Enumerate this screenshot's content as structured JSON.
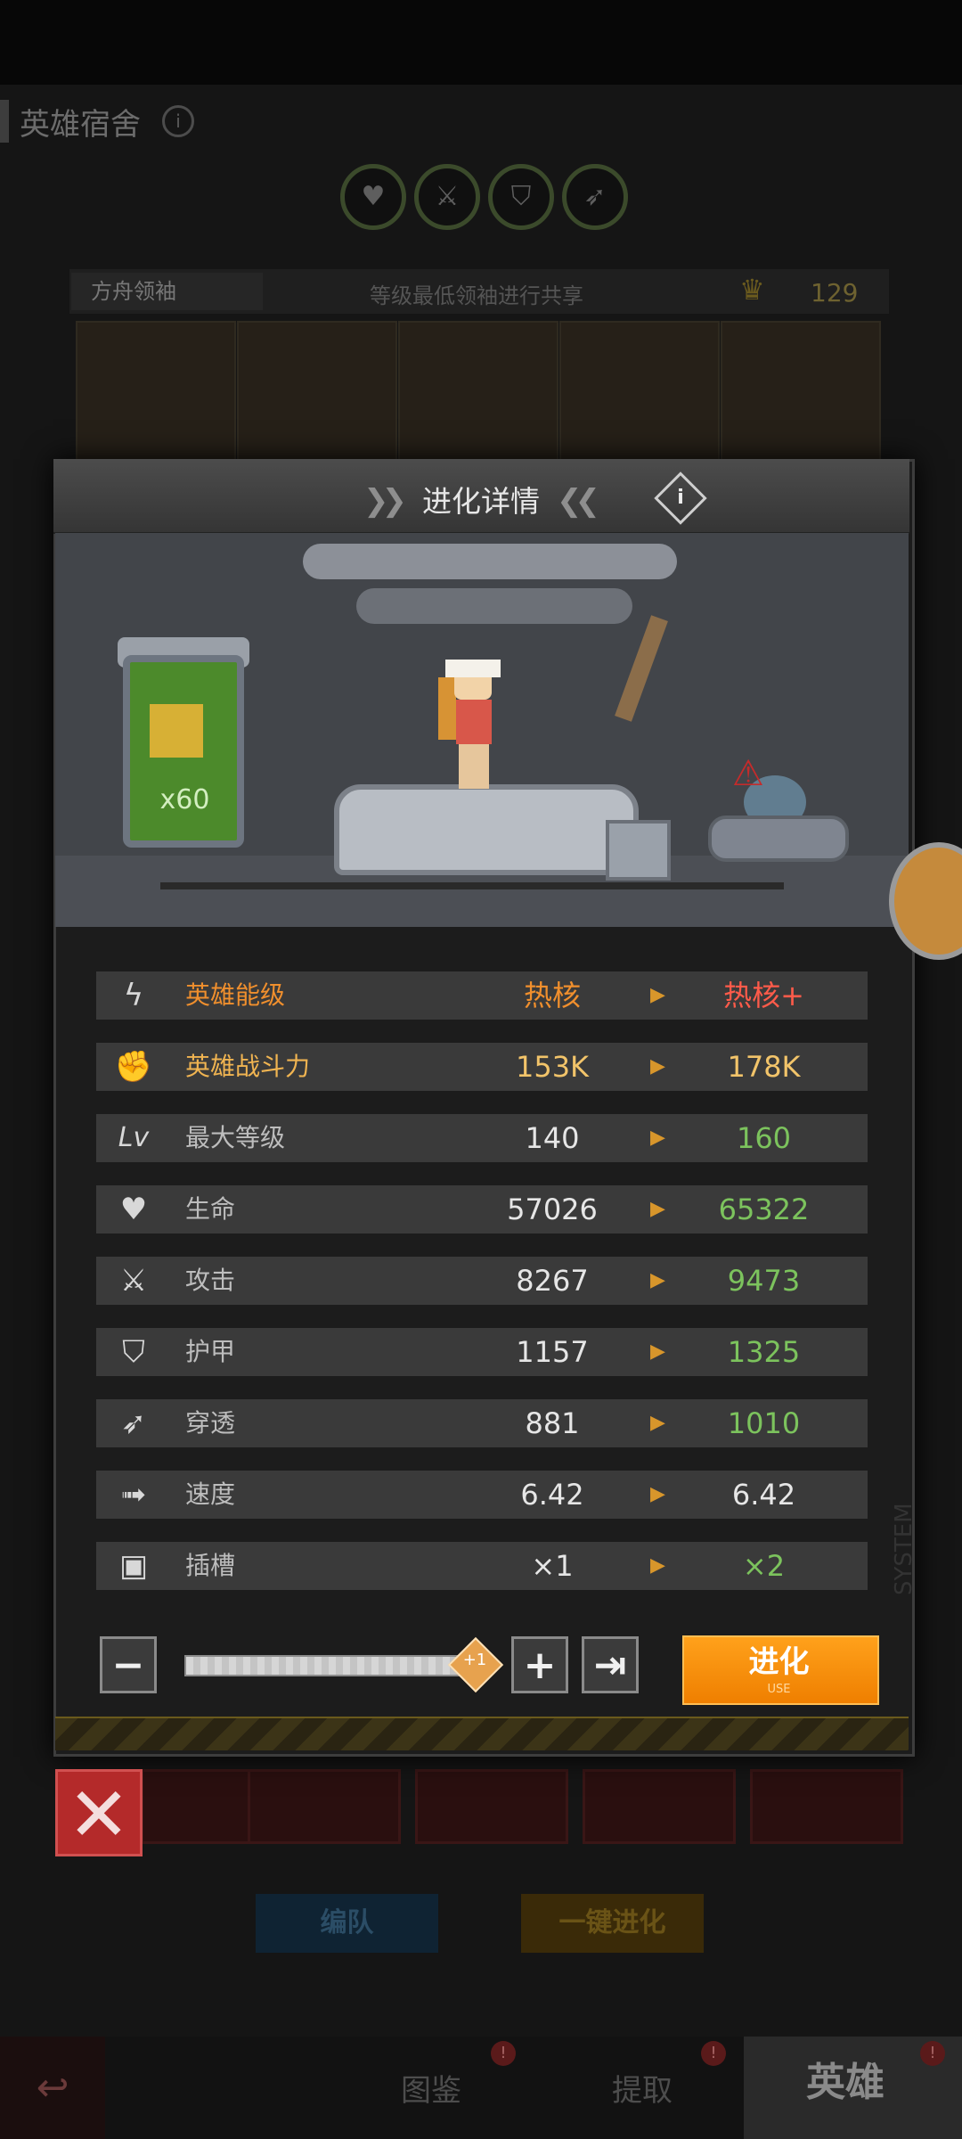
{
  "background_screen": {
    "title": "英雄宿舍",
    "filter_icons": [
      "heart-icon",
      "sword-icon",
      "shield-icon",
      "pierce-icon"
    ],
    "leader_label": "方舟领袖",
    "share_text": "等级最低领袖进行共享",
    "leader_level": "129",
    "team_button": "编队",
    "auto_evolve_button": "一键进化",
    "nav": {
      "codex": "图鉴",
      "extract": "提取",
      "hero": "英雄",
      "badge": "!"
    }
  },
  "modal": {
    "title": "进化详情",
    "info": "i",
    "tube_count": "x60",
    "stats": [
      {
        "icon": "energy-icon",
        "label": "英雄能级",
        "current": "热核",
        "next": "热核+"
      },
      {
        "icon": "fist-icon",
        "label": "英雄战斗力",
        "current": "153K",
        "next": "178K"
      },
      {
        "icon": "level-icon",
        "label": "最大等级",
        "current": "140",
        "next": "160"
      },
      {
        "icon": "heart-icon",
        "label": "生命",
        "current": "57026",
        "next": "65322"
      },
      {
        "icon": "sword-icon",
        "label": "攻击",
        "current": "8267",
        "next": "9473"
      },
      {
        "icon": "shield-icon",
        "label": "护甲",
        "current": "1157",
        "next": "1325"
      },
      {
        "icon": "pierce-icon",
        "label": "穿透",
        "current": "881",
        "next": "1010"
      },
      {
        "icon": "speed-icon",
        "label": "速度",
        "current": "6.42",
        "next": "6.42"
      },
      {
        "icon": "slot-icon",
        "label": "插槽",
        "current": "×1",
        "next": "×2"
      }
    ],
    "level_icon_text": "Lv",
    "slider_value": "+1",
    "minus": "−",
    "plus": "+",
    "max": "⇥",
    "evolve_label": "进化",
    "evolve_sub": "USE",
    "system_text": "SYSTEM",
    "colors": {
      "orange_text": "#f08f2d",
      "red_text": "#ff5b4a",
      "gold_text": "#f2c46a",
      "green_text": "#7cc35d",
      "evolve_button": "#ff9a12"
    }
  },
  "close": "✕"
}
